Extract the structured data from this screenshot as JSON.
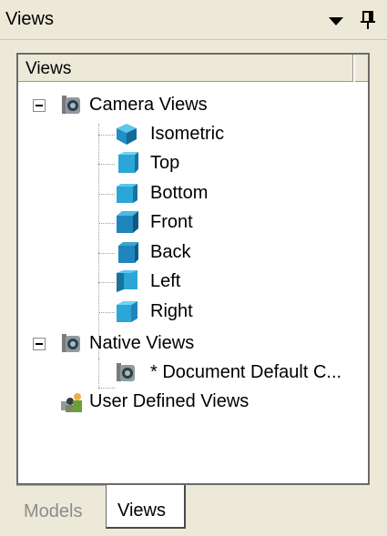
{
  "window": {
    "title": "Views"
  },
  "panel": {
    "column_header": "Views"
  },
  "tree": {
    "camera_views": {
      "label": "Camera Views",
      "children": [
        {
          "label": "Isometric",
          "icon": "cube-isometric-icon"
        },
        {
          "label": "Top",
          "icon": "cube-top-icon"
        },
        {
          "label": "Bottom",
          "icon": "cube-bottom-icon"
        },
        {
          "label": "Front",
          "icon": "cube-front-icon"
        },
        {
          "label": "Back",
          "icon": "cube-back-icon"
        },
        {
          "label": "Left",
          "icon": "cube-left-icon"
        },
        {
          "label": "Right",
          "icon": "cube-right-icon"
        }
      ]
    },
    "native_views": {
      "label": "Native Views",
      "children": [
        {
          "label": "* Document Default C...",
          "icon": "camera-icon"
        }
      ]
    },
    "user_defined_views": {
      "label": "User Defined Views",
      "icon": "users-icon"
    }
  },
  "tabs": [
    {
      "label": "Models",
      "active": false
    },
    {
      "label": "Views",
      "active": true
    }
  ],
  "colors": {
    "chrome": "#ece9d8",
    "cube": "#2ba6d6",
    "cube_dark": "#1777a8"
  }
}
